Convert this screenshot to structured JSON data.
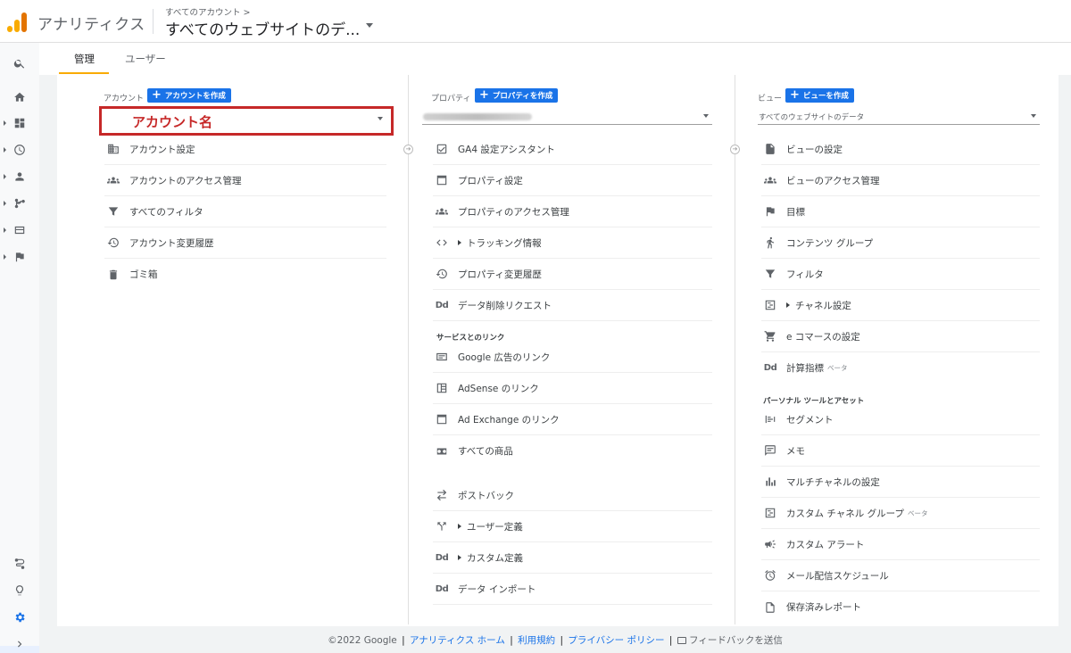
{
  "header": {
    "app_title": "アナリティクス",
    "breadcrumb": "すべてのアカウント >",
    "view_name": "すべてのウェブサイトのデ..."
  },
  "tabs": {
    "admin": "管理",
    "user": "ユーザー"
  },
  "columns": {
    "account": {
      "label": "アカウント",
      "create_button": "アカウントを作成",
      "selected": "アカウント名",
      "items": [
        {
          "label": "アカウント設定",
          "icon": "building-icon"
        },
        {
          "label": "アカウントのアクセス管理",
          "icon": "people-icon"
        },
        {
          "label": "すべてのフィルタ",
          "icon": "filter-icon"
        },
        {
          "label": "アカウント変更履歴",
          "icon": "history-icon"
        },
        {
          "label": "ゴミ箱",
          "icon": "trash-icon"
        }
      ]
    },
    "property": {
      "label": "プロパティ",
      "create_button": "プロパティを作成",
      "items": [
        {
          "label": "GA4 設定アシスタント",
          "icon": "check-box-icon"
        },
        {
          "label": "プロパティ設定",
          "icon": "window-icon"
        },
        {
          "label": "プロパティのアクセス管理",
          "icon": "people-icon"
        },
        {
          "label": "トラッキング情報",
          "icon": "code-icon"
        },
        {
          "label": "プロパティ変更履歴",
          "icon": "history-icon"
        },
        {
          "label": "データ削除リクエスト",
          "icon": "dd-icon"
        }
      ],
      "section_label": "サービスとのリンク",
      "link_items": [
        {
          "label": "Google 広告のリンク",
          "icon": "ads-icon"
        },
        {
          "label": "AdSense のリンク",
          "icon": "adsense-icon"
        },
        {
          "label": "Ad Exchange のリンク",
          "icon": "window-icon"
        },
        {
          "label": "すべての商品",
          "icon": "products-icon"
        }
      ],
      "more_items": [
        {
          "label": "ポストバック",
          "icon": "postback-icon"
        },
        {
          "label": "ユーザー定義",
          "icon": "fork-icon"
        },
        {
          "label": "カスタム定義",
          "icon": "dd-icon"
        },
        {
          "label": "データ インポート",
          "icon": "dd-icon"
        }
      ]
    },
    "view": {
      "label": "ビュー",
      "create_button": "ビューを作成",
      "selected": "すべてのウェブサイトのデータ",
      "items": [
        {
          "label": "ビューの設定",
          "icon": "document-icon"
        },
        {
          "label": "ビューのアクセス管理",
          "icon": "people-icon"
        },
        {
          "label": "目標",
          "icon": "flag-icon"
        },
        {
          "label": "コンテンツ グループ",
          "icon": "person-walk-icon"
        },
        {
          "label": "フィルタ",
          "icon": "filter-icon"
        },
        {
          "label": "チャネル設定",
          "icon": "channel-icon"
        },
        {
          "label": "e コマースの設定",
          "icon": "cart-icon"
        },
        {
          "label": "計算指標",
          "beta": "ベータ",
          "icon": "dd-icon"
        }
      ],
      "section_label": "パーソナル ツールとアセット",
      "personal_items": [
        {
          "label": "セグメント",
          "icon": "segment-icon"
        },
        {
          "label": "メモ",
          "icon": "comment-icon"
        },
        {
          "label": "マルチチャネルの設定",
          "icon": "bar-chart-icon"
        },
        {
          "label": "カスタム チャネル グループ",
          "beta": "ベータ",
          "icon": "channel-icon"
        },
        {
          "label": "カスタム アラート",
          "icon": "megaphone-icon"
        },
        {
          "label": "メール配信スケジュール",
          "icon": "alarm-icon"
        },
        {
          "label": "保存済みレポート",
          "icon": "document-icon"
        }
      ]
    }
  },
  "footer": {
    "copyright": "©2022 Google",
    "home": "アナリティクス ホーム",
    "terms": "利用規約",
    "privacy": "プライバシー ポリシー",
    "feedback": "フィードバックを送信"
  },
  "colors": {
    "accent": "#1a73e8",
    "highlight": "#c62828",
    "tab_underline": "#f9ab00"
  }
}
